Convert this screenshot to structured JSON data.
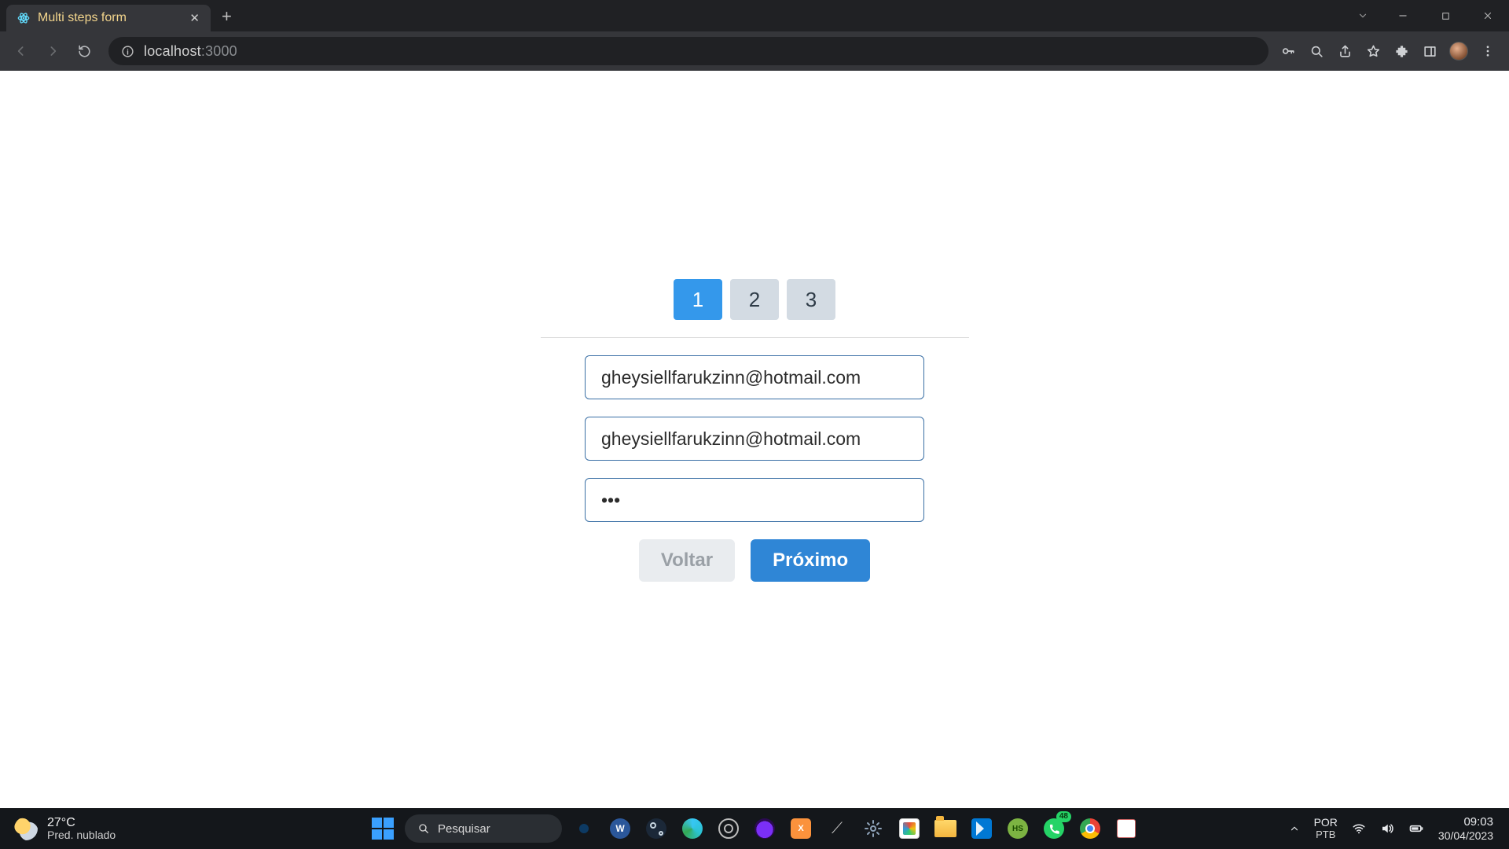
{
  "browser": {
    "tab_title": "Multi steps form",
    "url_host": "localhost",
    "url_port": ":3000"
  },
  "form": {
    "steps": [
      "1",
      "2",
      "3"
    ],
    "active_step_index": 0,
    "fields": {
      "email": "gheysiellfarukzinn@hotmail.com",
      "confirm_email": "gheysiellfarukzinn@hotmail.com",
      "password": "•••"
    },
    "buttons": {
      "back": "Voltar",
      "next": "Próximo"
    }
  },
  "taskbar": {
    "weather_temp": "27°C",
    "weather_desc": "Pred. nublado",
    "search_placeholder": "Pesquisar",
    "whatsapp_badge": "48",
    "lang_line1": "POR",
    "lang_line2": "PTB",
    "time": "09:03",
    "date": "30/04/2023"
  }
}
